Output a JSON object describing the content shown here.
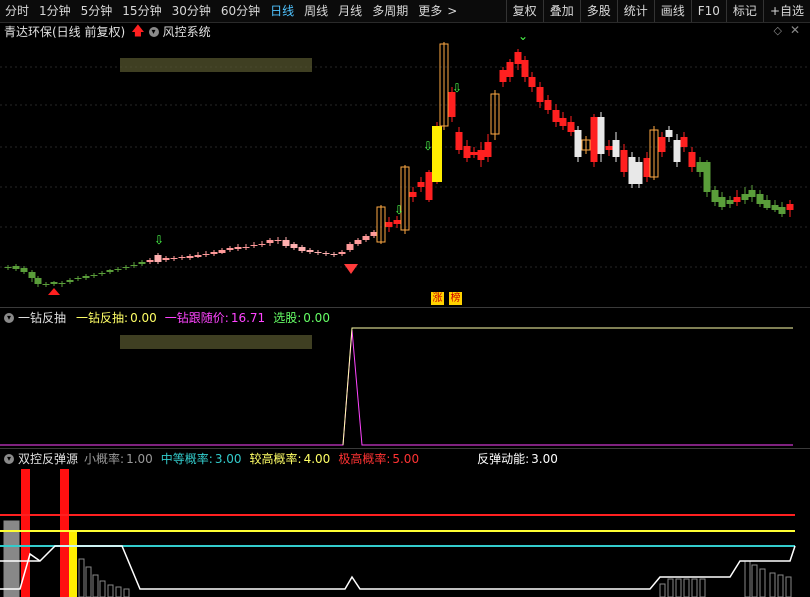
{
  "toolbar": {
    "periods": [
      "分时",
      "1分钟",
      "5分钟",
      "15分钟",
      "30分钟",
      "60分钟",
      "日线",
      "周线",
      "月线",
      "多周期",
      "更多"
    ],
    "active_period": "日线",
    "more_arrow": ">",
    "buttons": [
      "复权",
      "叠加",
      "多股",
      "统计",
      "画线",
      "F10",
      "标记",
      "+自选"
    ]
  },
  "main_panel": {
    "stock_title": "青达环保(日线 前复权)",
    "indicator_name": "风控系统",
    "badge_zhang": "涨",
    "badge_bang": "榜"
  },
  "panel2": {
    "name": "一钻反抽",
    "values": [
      {
        "label": "一钻反抽:",
        "value": "0.00",
        "color": "#ffff66"
      },
      {
        "label": "一钻跟随价:",
        "value": "16.71",
        "color": "#ff44ff"
      },
      {
        "label": "选股:",
        "value": "0.00",
        "color": "#66ff66"
      }
    ]
  },
  "panel3": {
    "name": "双控反弹源",
    "values": [
      {
        "label": "小概率:",
        "value": "1.00",
        "color": "#999999"
      },
      {
        "label": "中等概率:",
        "value": "3.00",
        "color": "#33cccc"
      },
      {
        "label": "较高概率:",
        "value": "4.00",
        "color": "#ffff66"
      },
      {
        "label": "极高概率:",
        "value": "5.00",
        "color": "#ff3333"
      },
      {
        "label": "反弹动能:",
        "value": "3.00",
        "color": "#ffffff"
      }
    ]
  },
  "colors": {
    "up": "#ff2020",
    "down": "#5a9e3a",
    "highlight": "#ffee00",
    "link": "#4fc3ff"
  }
}
